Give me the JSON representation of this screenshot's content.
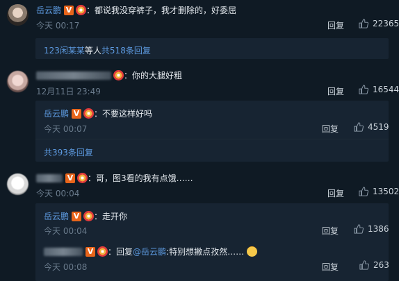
{
  "comments": [
    {
      "user": "岳云鹏",
      "verified_badge": "V",
      "text": "：都说我没穿裤子，我才删除的，好委屈",
      "time": "今天 00:17",
      "reply_label": "回复",
      "likes": "22365",
      "replies_summary": {
        "names": "123闲某某",
        "mid": " 等人 ",
        "count": "共518条回复"
      }
    },
    {
      "user": "",
      "text": "：你的大腿好粗",
      "time": "12月11日 23:49",
      "reply_label": "回复",
      "likes": "16544",
      "sub_reply": {
        "user": "岳云鹏",
        "verified_badge": "V",
        "text": "：不要这样好吗",
        "time": "今天 00:07",
        "reply_label": "回复",
        "likes": "4519"
      },
      "more_replies": "共393条回复"
    },
    {
      "user": "",
      "verified_badge": "V",
      "text": "：哥，图3看的我有点饿……",
      "time": "今天 00:04",
      "reply_label": "回复",
      "likes": "13502",
      "sub_replies": [
        {
          "user": "岳云鹏",
          "verified_badge": "V",
          "text": "：走开你",
          "time": "今天 00:04",
          "reply_label": "回复",
          "likes": "1386"
        },
        {
          "user": "",
          "verified_badge": "V",
          "text_prefix": "：回复",
          "mention": "@岳云鹏",
          "text": ":特别想撇点孜然……",
          "time": "今天 00:08",
          "reply_label": "回复",
          "likes": "263"
        }
      ]
    }
  ]
}
